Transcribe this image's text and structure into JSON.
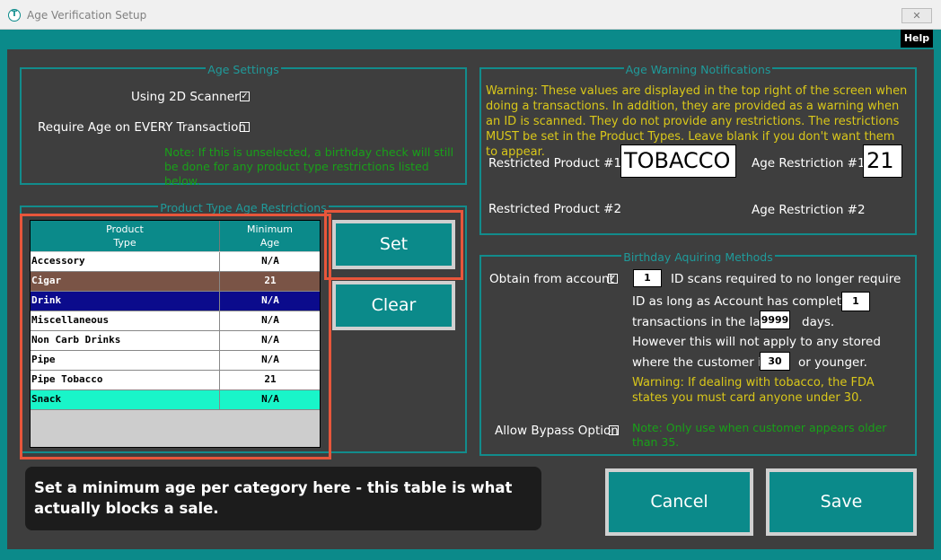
{
  "window": {
    "title": "Age Verification Setup",
    "close_glyph": "✕",
    "help_label": "Help"
  },
  "age_settings": {
    "legend": "Age Settings",
    "use_2d_label": "Using 2D Scanner",
    "use_2d_checked": "✓",
    "require_age_label": "Require Age on EVERY Transaction",
    "require_age_checked": "",
    "note": "Note: If this is unselected, a birthday check will still be done for any product type restrictions listed below."
  },
  "product_restrictions": {
    "legend": "Product Type Age Restrictions",
    "columns": [
      "Product\nType",
      "Minimum\nAge"
    ],
    "col1_l1": "Product",
    "col1_l2": "Type",
    "col2_l1": "Minimum",
    "col2_l2": "Age",
    "rows": [
      {
        "type": "Accessory",
        "age": "N/A",
        "bg": "#ffffff",
        "fg": "#000000"
      },
      {
        "type": "Cigar",
        "age": "21",
        "bg": "#7a5446",
        "fg": "#ffffff"
      },
      {
        "type": "Drink",
        "age": "N/A",
        "bg": "#0b0b8c",
        "fg": "#ffffff"
      },
      {
        "type": "Miscellaneous",
        "age": "N/A",
        "bg": "#ffffff",
        "fg": "#000000"
      },
      {
        "type": "Non Carb Drinks",
        "age": "N/A",
        "bg": "#ffffff",
        "fg": "#000000"
      },
      {
        "type": "Pipe",
        "age": "N/A",
        "bg": "#ffffff",
        "fg": "#000000"
      },
      {
        "type": "Pipe Tobacco",
        "age": "21",
        "bg": "#ffffff",
        "fg": "#000000"
      },
      {
        "type": "Snack",
        "age": "N/A",
        "bg": "#19f5c9",
        "fg": "#000000"
      }
    ],
    "set_label": "Set",
    "clear_label": "Clear"
  },
  "warning_notifications": {
    "legend": "Age Warning Notifications",
    "warning_text": "Warning: These values are displayed in the top right of the screen when doing a transactions. In addition, they are provided as a warning when an ID is scanned. They do not provide any restrictions. The restrictions MUST be set in the Product Types. Leave blank if you don't want them to appear.",
    "restricted_1_label": "Restricted Product #1",
    "restricted_1_value": "TOBACCO",
    "age_restriction_1_label": "Age Restriction #1",
    "age_restriction_1_value": "21",
    "restricted_2_label": "Restricted Product #2",
    "age_restriction_2_label": "Age Restriction #2"
  },
  "birthday_methods": {
    "legend": "Birthday Aquiring Methods",
    "obtain_label": "Obtain from account",
    "obtain_checked": "✓",
    "id_scans_value": "1",
    "id_scans_text": "ID scans required to no longer require",
    "line2_text": "ID as long as Account has completed",
    "transactions_value": "1",
    "line3_text": "transactions in the last",
    "days_value": "9999",
    "days_text": "days.",
    "line4_text": "However this will not apply to any stored",
    "line5_text": "where the customer is",
    "age_value": "30",
    "younger_text": "or younger.",
    "fda_warning": "Warning: If dealing with tobacco, the FDA states you must card anyone under 30.",
    "bypass_label": "Allow Bypass Option",
    "bypass_checked": "",
    "bypass_note": "Note: Only use when customer appears older than 35."
  },
  "actions": {
    "cancel_label": "Cancel",
    "save_label": "Save"
  },
  "tooltip": {
    "text": "Set a minimum age per category here - this table is what actually blocks a sale."
  },
  "colors": {
    "accent": "#0b8a8a",
    "highlight": "#e8563b"
  }
}
